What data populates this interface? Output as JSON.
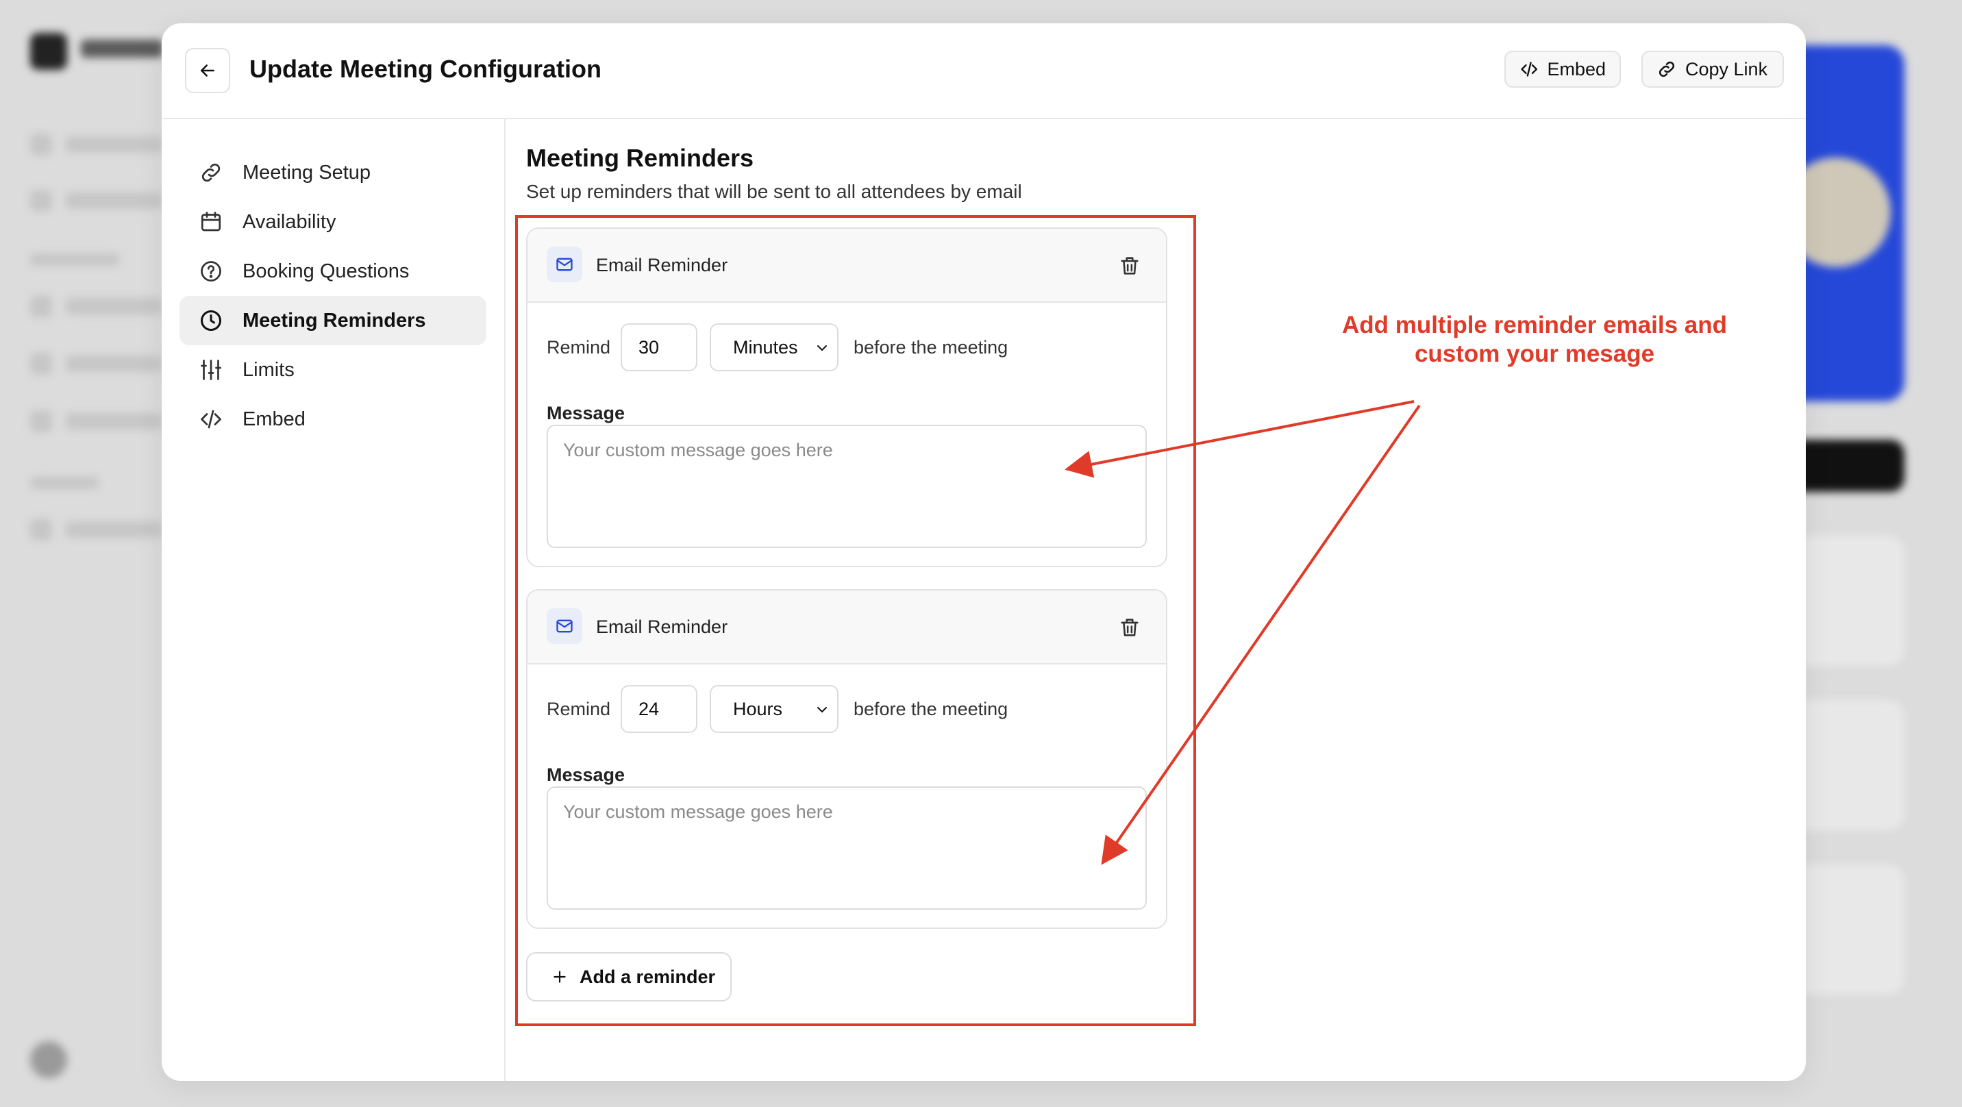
{
  "header": {
    "title": "Update Meeting Configuration",
    "embed_label": "Embed",
    "copy_link_label": "Copy Link"
  },
  "sidebar": {
    "items": [
      {
        "label": "Meeting Setup",
        "icon": "link-icon"
      },
      {
        "label": "Availability",
        "icon": "calendar-icon"
      },
      {
        "label": "Booking Questions",
        "icon": "question-icon"
      },
      {
        "label": "Meeting Reminders",
        "icon": "clock-icon",
        "active": true
      },
      {
        "label": "Limits",
        "icon": "sliders-icon"
      },
      {
        "label": "Embed",
        "icon": "code-icon"
      }
    ]
  },
  "main": {
    "title": "Meeting Reminders",
    "subtitle": "Set up reminders that will be sent to all attendees by email",
    "reminders": [
      {
        "title": "Email Reminder",
        "remind_label": "Remind",
        "amount": "30",
        "unit": "Minutes",
        "suffix": "before the meeting",
        "message_label": "Message",
        "message_placeholder": "Your custom message goes here"
      },
      {
        "title": "Email Reminder",
        "remind_label": "Remind",
        "amount": "24",
        "unit": "Hours",
        "suffix": "before the meeting",
        "message_label": "Message",
        "message_placeholder": "Your custom message goes here"
      }
    ],
    "add_reminder_label": "Add a reminder"
  },
  "annotation": {
    "line1": "Add multiple reminder emails and",
    "line2": "custom your mesage",
    "color": "#e03a28"
  },
  "colors": {
    "accent_blue": "#2548d8",
    "active_bg": "#efefef"
  }
}
